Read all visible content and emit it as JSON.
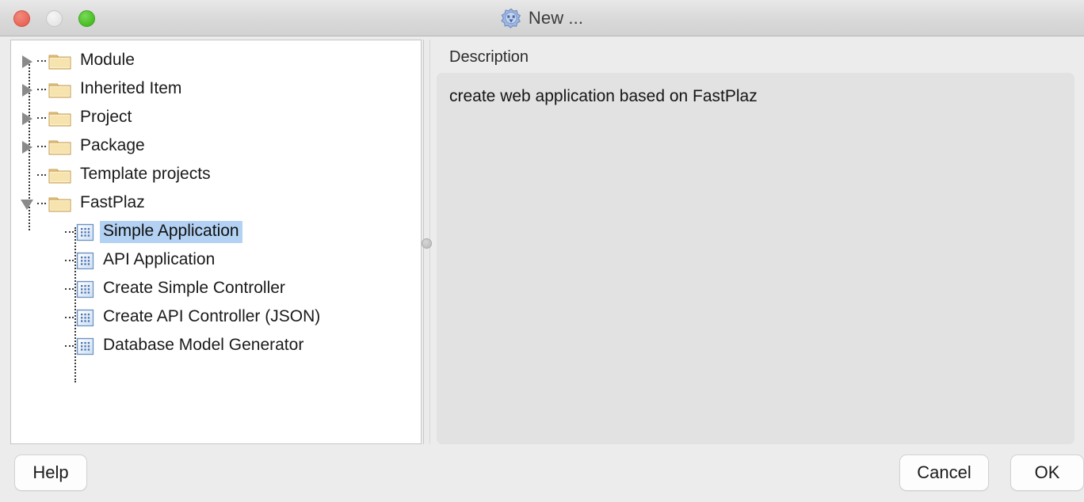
{
  "window": {
    "title": "New ...",
    "icon": "gear-star-icon",
    "traffic_lights": {
      "close": {
        "name": "close-button",
        "color": "#ec6a5c"
      },
      "minimize": {
        "name": "minimize-button",
        "color": "#e6e6e6"
      },
      "maximize": {
        "name": "maximize-button",
        "color": "#4fc127"
      }
    }
  },
  "colors": {
    "window_bg": "#ececec",
    "panel_bg": "#ffffff",
    "selection": "#b3d1f2",
    "description_bg": "#e2e2e2",
    "folder_icon": "#e8c57a",
    "item_icon": "#5b86c4"
  },
  "tree": {
    "items": [
      {
        "label": "Module",
        "level": 1,
        "icon": "folder-icon",
        "twisty": "closed",
        "selected": false
      },
      {
        "label": "Inherited Item",
        "level": 1,
        "icon": "folder-icon",
        "twisty": "closed",
        "selected": false
      },
      {
        "label": "Project",
        "level": 1,
        "icon": "folder-icon",
        "twisty": "closed",
        "selected": false
      },
      {
        "label": "Package",
        "level": 1,
        "icon": "folder-icon",
        "twisty": "closed",
        "selected": false
      },
      {
        "label": "Template projects",
        "level": 1,
        "icon": "folder-icon",
        "twisty": "none",
        "selected": false
      },
      {
        "label": "FastPlaz",
        "level": 1,
        "icon": "folder-icon",
        "twisty": "open",
        "selected": false
      },
      {
        "label": "Simple Application",
        "level": 2,
        "icon": "template-item-icon",
        "twisty": "none",
        "selected": true
      },
      {
        "label": "API Application",
        "level": 2,
        "icon": "template-item-icon",
        "twisty": "none",
        "selected": false
      },
      {
        "label": "Create Simple Controller",
        "level": 2,
        "icon": "template-item-icon",
        "twisty": "none",
        "selected": false
      },
      {
        "label": "Create API Controller (JSON)",
        "level": 2,
        "icon": "template-item-icon",
        "twisty": "none",
        "selected": false
      },
      {
        "label": "Database Model Generator",
        "level": 2,
        "icon": "template-item-icon",
        "twisty": "none",
        "selected": false
      }
    ]
  },
  "description": {
    "heading": "Description",
    "text": "create web application based on FastPlaz"
  },
  "footer": {
    "help_label": "Help",
    "cancel_label": "Cancel",
    "ok_label": "OK"
  }
}
